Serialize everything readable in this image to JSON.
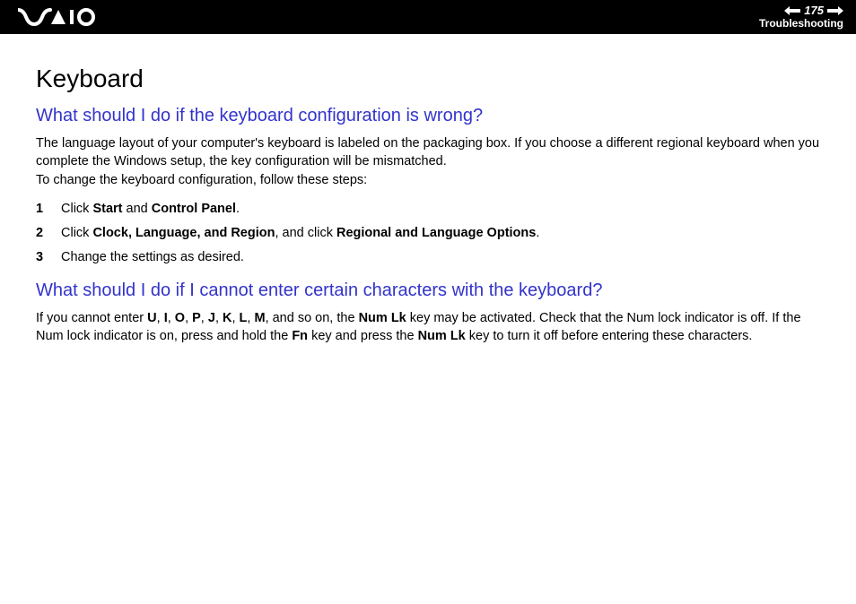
{
  "header": {
    "page_number": "175",
    "section": "Troubleshooting"
  },
  "content": {
    "title": "Keyboard",
    "q1": {
      "heading": "What should I do if the keyboard configuration is wrong?",
      "para1": "The language layout of your computer's keyboard is labeled on the packaging box. If you choose a different regional keyboard when you complete the Windows setup, the key configuration will be mismatched.",
      "para2": "To change the keyboard configuration, follow these steps:",
      "steps": {
        "s1": {
          "pre": "Click ",
          "b1": "Start",
          "mid": " and ",
          "b2": "Control Panel",
          "post": "."
        },
        "s2": {
          "pre": "Click ",
          "b1": "Clock, Language, and Region",
          "mid": ", and click ",
          "b2": "Regional and Language Options",
          "post": "."
        },
        "s3": {
          "text": "Change the settings as desired."
        }
      }
    },
    "q2": {
      "heading": "What should I do if I cannot enter certain characters with the keyboard?",
      "para": {
        "t1": "If you cannot enter ",
        "k1": "U",
        "c1": ", ",
        "k2": "I",
        "c2": ", ",
        "k3": "O",
        "c3": ", ",
        "k4": "P",
        "c4": ", ",
        "k5": "J",
        "c5": ", ",
        "k6": "K",
        "c6": ", ",
        "k7": "L",
        "c7": ", ",
        "k8": "M",
        "t2": ", and so on, the ",
        "numlk1": "Num Lk",
        "t3": " key may be activated. Check that the Num lock indicator is off. If the Num lock indicator is on, press and hold the ",
        "fn": "Fn",
        "t4": " key and press the ",
        "numlk2": "Num Lk",
        "t5": " key to turn it off before entering these characters."
      }
    }
  }
}
